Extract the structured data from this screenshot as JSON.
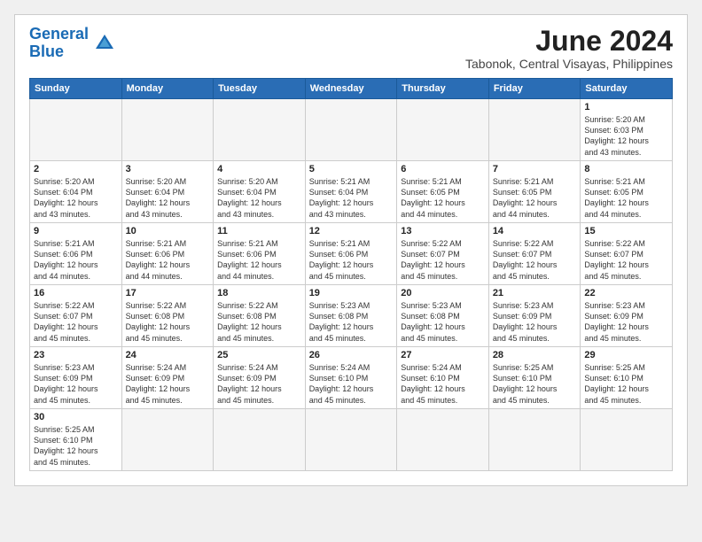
{
  "header": {
    "logo_general": "General",
    "logo_blue": "Blue",
    "month_year": "June 2024",
    "location": "Tabonok, Central Visayas, Philippines"
  },
  "weekdays": [
    "Sunday",
    "Monday",
    "Tuesday",
    "Wednesday",
    "Thursday",
    "Friday",
    "Saturday"
  ],
  "weeks": [
    [
      {
        "day": "",
        "info": ""
      },
      {
        "day": "",
        "info": ""
      },
      {
        "day": "",
        "info": ""
      },
      {
        "day": "",
        "info": ""
      },
      {
        "day": "",
        "info": ""
      },
      {
        "day": "",
        "info": ""
      },
      {
        "day": "1",
        "info": "Sunrise: 5:20 AM\nSunset: 6:03 PM\nDaylight: 12 hours\nand 43 minutes."
      }
    ],
    [
      {
        "day": "2",
        "info": "Sunrise: 5:20 AM\nSunset: 6:04 PM\nDaylight: 12 hours\nand 43 minutes."
      },
      {
        "day": "3",
        "info": "Sunrise: 5:20 AM\nSunset: 6:04 PM\nDaylight: 12 hours\nand 43 minutes."
      },
      {
        "day": "4",
        "info": "Sunrise: 5:20 AM\nSunset: 6:04 PM\nDaylight: 12 hours\nand 43 minutes."
      },
      {
        "day": "5",
        "info": "Sunrise: 5:21 AM\nSunset: 6:04 PM\nDaylight: 12 hours\nand 43 minutes."
      },
      {
        "day": "6",
        "info": "Sunrise: 5:21 AM\nSunset: 6:05 PM\nDaylight: 12 hours\nand 44 minutes."
      },
      {
        "day": "7",
        "info": "Sunrise: 5:21 AM\nSunset: 6:05 PM\nDaylight: 12 hours\nand 44 minutes."
      },
      {
        "day": "8",
        "info": "Sunrise: 5:21 AM\nSunset: 6:05 PM\nDaylight: 12 hours\nand 44 minutes."
      }
    ],
    [
      {
        "day": "9",
        "info": "Sunrise: 5:21 AM\nSunset: 6:06 PM\nDaylight: 12 hours\nand 44 minutes."
      },
      {
        "day": "10",
        "info": "Sunrise: 5:21 AM\nSunset: 6:06 PM\nDaylight: 12 hours\nand 44 minutes."
      },
      {
        "day": "11",
        "info": "Sunrise: 5:21 AM\nSunset: 6:06 PM\nDaylight: 12 hours\nand 44 minutes."
      },
      {
        "day": "12",
        "info": "Sunrise: 5:21 AM\nSunset: 6:06 PM\nDaylight: 12 hours\nand 45 minutes."
      },
      {
        "day": "13",
        "info": "Sunrise: 5:22 AM\nSunset: 6:07 PM\nDaylight: 12 hours\nand 45 minutes."
      },
      {
        "day": "14",
        "info": "Sunrise: 5:22 AM\nSunset: 6:07 PM\nDaylight: 12 hours\nand 45 minutes."
      },
      {
        "day": "15",
        "info": "Sunrise: 5:22 AM\nSunset: 6:07 PM\nDaylight: 12 hours\nand 45 minutes."
      }
    ],
    [
      {
        "day": "16",
        "info": "Sunrise: 5:22 AM\nSunset: 6:07 PM\nDaylight: 12 hours\nand 45 minutes."
      },
      {
        "day": "17",
        "info": "Sunrise: 5:22 AM\nSunset: 6:08 PM\nDaylight: 12 hours\nand 45 minutes."
      },
      {
        "day": "18",
        "info": "Sunrise: 5:22 AM\nSunset: 6:08 PM\nDaylight: 12 hours\nand 45 minutes."
      },
      {
        "day": "19",
        "info": "Sunrise: 5:23 AM\nSunset: 6:08 PM\nDaylight: 12 hours\nand 45 minutes."
      },
      {
        "day": "20",
        "info": "Sunrise: 5:23 AM\nSunset: 6:08 PM\nDaylight: 12 hours\nand 45 minutes."
      },
      {
        "day": "21",
        "info": "Sunrise: 5:23 AM\nSunset: 6:09 PM\nDaylight: 12 hours\nand 45 minutes."
      },
      {
        "day": "22",
        "info": "Sunrise: 5:23 AM\nSunset: 6:09 PM\nDaylight: 12 hours\nand 45 minutes."
      }
    ],
    [
      {
        "day": "23",
        "info": "Sunrise: 5:23 AM\nSunset: 6:09 PM\nDaylight: 12 hours\nand 45 minutes."
      },
      {
        "day": "24",
        "info": "Sunrise: 5:24 AM\nSunset: 6:09 PM\nDaylight: 12 hours\nand 45 minutes."
      },
      {
        "day": "25",
        "info": "Sunrise: 5:24 AM\nSunset: 6:09 PM\nDaylight: 12 hours\nand 45 minutes."
      },
      {
        "day": "26",
        "info": "Sunrise: 5:24 AM\nSunset: 6:10 PM\nDaylight: 12 hours\nand 45 minutes."
      },
      {
        "day": "27",
        "info": "Sunrise: 5:24 AM\nSunset: 6:10 PM\nDaylight: 12 hours\nand 45 minutes."
      },
      {
        "day": "28",
        "info": "Sunrise: 5:25 AM\nSunset: 6:10 PM\nDaylight: 12 hours\nand 45 minutes."
      },
      {
        "day": "29",
        "info": "Sunrise: 5:25 AM\nSunset: 6:10 PM\nDaylight: 12 hours\nand 45 minutes."
      }
    ],
    [
      {
        "day": "30",
        "info": "Sunrise: 5:25 AM\nSunset: 6:10 PM\nDaylight: 12 hours\nand 45 minutes."
      },
      {
        "day": "",
        "info": ""
      },
      {
        "day": "",
        "info": ""
      },
      {
        "day": "",
        "info": ""
      },
      {
        "day": "",
        "info": ""
      },
      {
        "day": "",
        "info": ""
      },
      {
        "day": "",
        "info": ""
      }
    ]
  ]
}
